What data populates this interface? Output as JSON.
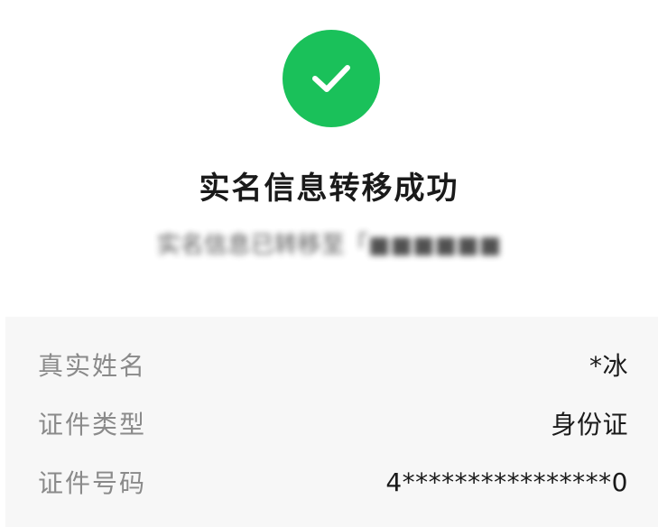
{
  "status": {
    "icon": "checkmark-icon",
    "circle_color": "#1AC15A",
    "title": "实名信息转移成功",
    "subtitle": "实名信息已转移至「■■■■■■"
  },
  "identity_info": {
    "rows": [
      {
        "label": "真实姓名",
        "value": "*冰"
      },
      {
        "label": "证件类型",
        "value": "身份证"
      },
      {
        "label": "证件号码",
        "value": "4****************0"
      }
    ]
  }
}
